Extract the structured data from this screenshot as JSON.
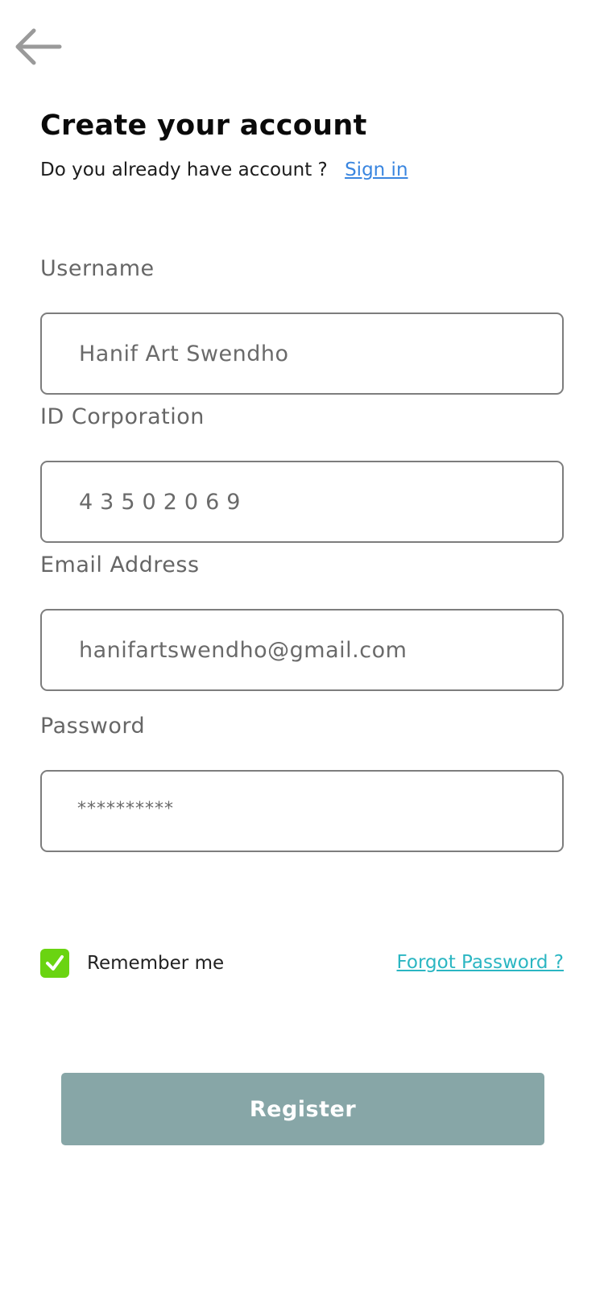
{
  "header": {
    "back_icon": "arrow-left-icon"
  },
  "page": {
    "title": "Create your account",
    "subtitle": "Do you already have account ?",
    "signin_link": "Sign in"
  },
  "form": {
    "username": {
      "label": "Username",
      "value": "Hanif Art Swendho"
    },
    "id_corporation": {
      "label": "ID Corporation",
      "value": "43502069"
    },
    "email": {
      "label": "Email Address",
      "value": "hanifartswendho@gmail.com"
    },
    "password": {
      "label": "Password",
      "value": "**********"
    }
  },
  "options": {
    "remember_label": "Remember me",
    "remember_checked": true,
    "check_icon": "checkmark-icon",
    "forgot_link": "Forgot Password ?"
  },
  "actions": {
    "register_label": "Register"
  },
  "colors": {
    "link_blue": "#3a86e0",
    "forgot_teal": "#2bb6c2",
    "checkbox_green": "#6ad411",
    "button_bg": "#87a6a7",
    "field_border": "#7d7d7d"
  }
}
